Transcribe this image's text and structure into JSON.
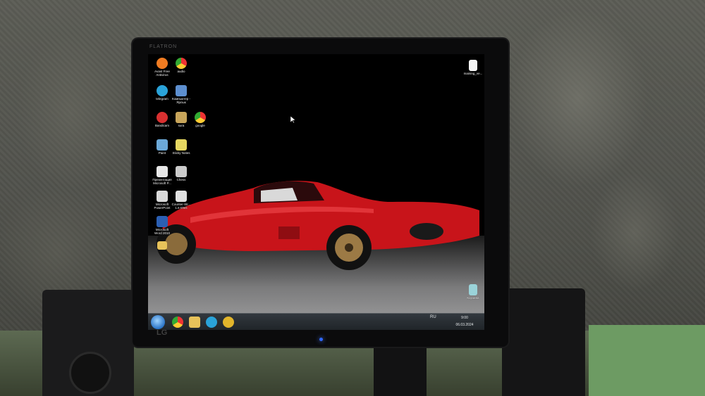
{
  "monitor": {
    "brand_top": "FLATRON",
    "brand_bottom": "LG"
  },
  "desktop_icons": [
    {
      "id": "avast",
      "label": "Avast Free Antivirus",
      "color": "#f07b21"
    },
    {
      "id": "audio",
      "label": "audio",
      "color": "#4caf50"
    },
    {
      "id": "telegram",
      "label": "telegram",
      "color": "#2aa3d9"
    },
    {
      "id": "computer",
      "label": "Компьютер - Ярлык",
      "color": "#5d8fcf"
    },
    {
      "id": "bandicam",
      "label": "Bandicam",
      "color": "#d93030"
    },
    {
      "id": "sura",
      "label": "sura",
      "color": "#c8a55a"
    },
    {
      "id": "google",
      "label": "google",
      "color": "#4caf50"
    },
    {
      "id": "paint",
      "label": "Paint",
      "color": "#6ca9d8"
    },
    {
      "id": "sticky",
      "label": "Sticky Notes",
      "color": "#e6d760"
    },
    {
      "id": "presentation",
      "label": "Презентация Microsoft P...",
      "color": "#e8e8e8"
    },
    {
      "id": "chess",
      "label": "Chess",
      "color": "#cccccc"
    },
    {
      "id": "powerpoint",
      "label": "Microsoft PowerPoint",
      "color": "#d9d9d9"
    },
    {
      "id": "counter",
      "label": "Counter-Str... 1.6 ENG",
      "color": "#e0e0e0"
    },
    {
      "id": "word",
      "label": "Microsoft Word 2010",
      "color": "#2b5fb3"
    },
    {
      "id": "folder",
      "label": "",
      "color": "#e7c25a"
    },
    {
      "id": "file",
      "label": "maining_ve...",
      "color": "#f4f4f4"
    },
    {
      "id": "recycle",
      "label": "Корзина",
      "color": "#9ad3d9"
    }
  ],
  "taskbar": {
    "language": "RU",
    "time": "9:00",
    "date": "06.03.2024",
    "pinned": [
      {
        "id": "chrome",
        "color": "#4caf50"
      },
      {
        "id": "explorer",
        "color": "#e7c25a"
      },
      {
        "id": "telegram",
        "color": "#2aa3d9"
      },
      {
        "id": "game",
        "color": "#e2b52b"
      }
    ]
  },
  "wallpaper": {
    "car_color": "#c8141a"
  }
}
